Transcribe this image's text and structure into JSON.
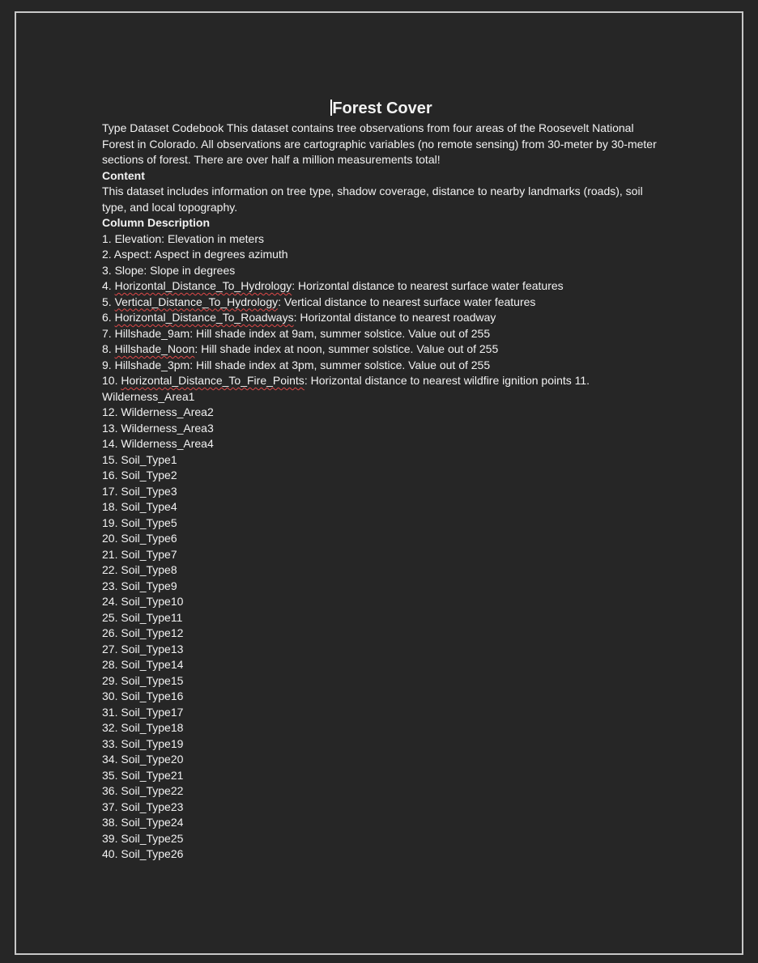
{
  "document": {
    "title": "Forest Cover",
    "intro": " Type Dataset Codebook This dataset contains tree observations from four areas of the Roosevelt National Forest in Colorado. All observations are cartographic variables (no remote sensing) from 30-meter by 30-meter sections of forest. There are over half a million measurements total!",
    "content_heading": "Content",
    "content_text": " This dataset includes information on tree type, shadow coverage, distance to nearby landmarks (roads), soil type, and local topography.",
    "column_heading": "Column Description",
    "columns": [
      {
        "num": "1. ",
        "name": "Elevation",
        "desc": ": Elevation in meters"
      },
      {
        "num": "2. ",
        "name": "Aspect",
        "desc": ": Aspect in degrees azimuth"
      },
      {
        "num": "3. ",
        "name": "Slope",
        "desc": ": Slope in degrees"
      },
      {
        "num": "4. ",
        "name": "Horizontal_Distance_To_Hydrology",
        "desc": ": Horizontal distance to nearest surface water features"
      },
      {
        "num": "5. ",
        "name": "Vertical_Distance_To_Hydrology",
        "desc": ": Vertical distance to nearest surface water features"
      },
      {
        "num": "6. ",
        "name": "Horizontal_Distance_To_Roadways",
        "desc": ": Horizontal distance to nearest roadway"
      },
      {
        "num": "7. ",
        "name": "Hillshade_9am",
        "desc": ": Hill shade index at 9am, summer solstice. Value out of 255"
      },
      {
        "num": "8. ",
        "name": "Hillshade_Noon",
        "desc": ": Hill shade index at noon, summer solstice. Value out of 255"
      },
      {
        "num": "9. ",
        "name": "Hillshade_3pm",
        "desc": ": Hill shade index at 3pm, summer solstice. Value out of 255"
      },
      {
        "num": "10. ",
        "name": "Horizontal_Distance_To_Fire_Points",
        "desc": ": Horizontal distance to nearest wildfire ignition points 11."
      }
    ],
    "wrap_line": "Wilderness_Area1",
    "items": [
      "12. Wilderness_Area2",
      "13. Wilderness_Area3",
      "14. Wilderness_Area4",
      "15. Soil_Type1",
      "16. Soil_Type2",
      "17. Soil_Type3",
      "18. Soil_Type4",
      "19. Soil_Type5",
      "20. Soil_Type6",
      "21. Soil_Type7",
      "22. Soil_Type8",
      "23. Soil_Type9",
      "24. Soil_Type10",
      "25. Soil_Type11",
      "26. Soil_Type12",
      "27. Soil_Type13",
      "28. Soil_Type14",
      "29. Soil_Type15",
      "30. Soil_Type16",
      "31. Soil_Type17",
      "32. Soil_Type18",
      "33. Soil_Type19",
      "34. Soil_Type20",
      "35. Soil_Type21",
      "36. Soil_Type22",
      "37. Soil_Type23",
      "38. Soil_Type24",
      "39. Soil_Type25",
      "40. Soil_Type26"
    ]
  }
}
